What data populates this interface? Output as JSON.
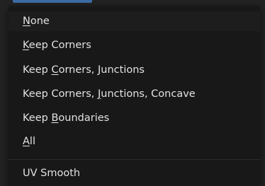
{
  "menu": {
    "items": [
      {
        "pre": "",
        "mnemonic": "N",
        "post": "one"
      },
      {
        "pre": "",
        "mnemonic": "K",
        "post": "eep Corners"
      },
      {
        "pre": "Keep ",
        "mnemonic": "C",
        "post": "orners, Junctions"
      },
      {
        "pre": "Keep Corners, ",
        "mnemonic": "J",
        "post": "unctions, Concave"
      },
      {
        "pre": "Keep ",
        "mnemonic": "B",
        "post": "oundaries"
      },
      {
        "pre": "",
        "mnemonic": "A",
        "post": "ll"
      }
    ],
    "footer_item": {
      "label": "UV Smooth"
    }
  },
  "colors": {
    "menu_bg": "#181818",
    "text": "#e2e2e2",
    "accent": "#3f6fa8"
  }
}
